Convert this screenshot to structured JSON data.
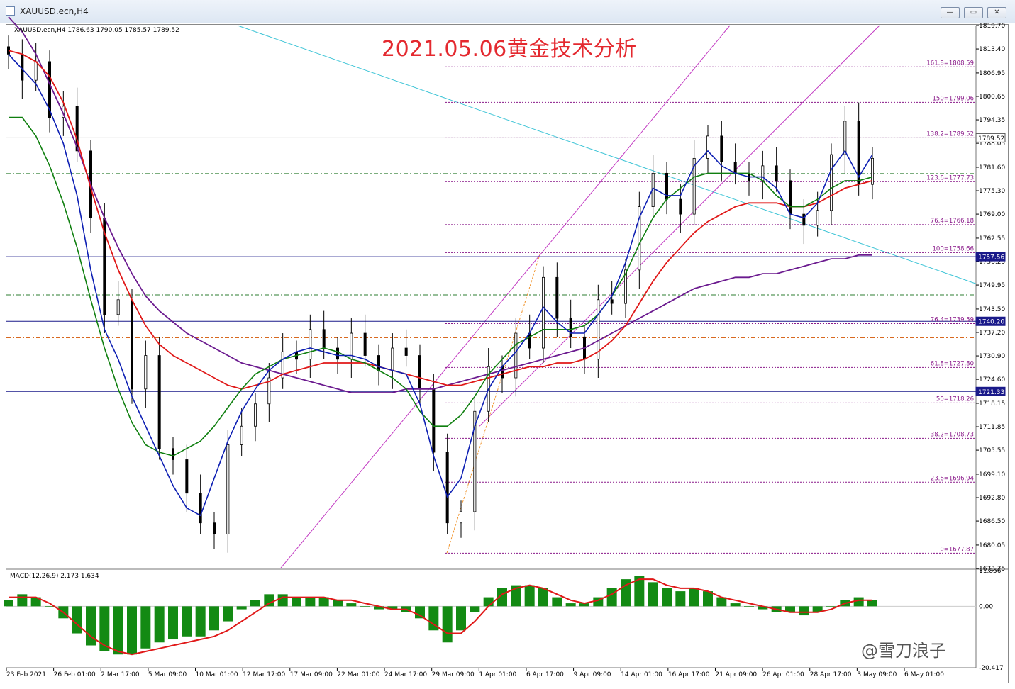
{
  "window": {
    "title": "XAUUSD.ecn,H4",
    "buttons": {
      "minimize": "—",
      "restore": "▭",
      "close": "✕"
    }
  },
  "chart_header": {
    "symbol_line": "XAUUSD.ecn,H4  1786.63 1790.05 1785.57 1789.52",
    "macd_line": "MACD(12,26,9) 2.173 1.634"
  },
  "headline": "2021.05.06黄金技术分析",
  "watermark": "@雪刀浪子",
  "colors": {
    "candle": "#000000",
    "ma_fast": "#0d1fb3",
    "ma_green": "#0f7f0f",
    "ma_red": "#e01818",
    "ma_purple": "#6b1a8f",
    "fib": "#8a1a8a",
    "trend_cyan": "#3cc4d6",
    "channel": "#c23ac2",
    "hline": "#1a1a8a",
    "macd_hist": "#138a13",
    "macd_signal": "#e01818",
    "headline": "#e4292f"
  },
  "chart_data": {
    "type": "candlestick",
    "symbol": "XAUUSD.ecn",
    "timeframe": "H4",
    "last": {
      "open": 1786.63,
      "high": 1790.05,
      "low": 1785.57,
      "close": 1789.52
    },
    "price_axis": [
      1819.7,
      1813.4,
      1806.95,
      1800.65,
      1794.35,
      1788.05,
      1781.6,
      1775.3,
      1769.0,
      1762.55,
      1756.25,
      1749.95,
      1743.5,
      1737.2,
      1730.9,
      1724.6,
      1718.15,
      1711.85,
      1705.55,
      1699.1,
      1692.8,
      1686.5,
      1680.05,
      1673.75
    ],
    "ylim": [
      1673.75,
      1819.7
    ],
    "time_axis": [
      "23 Feb 2021",
      "26 Feb 01:00",
      "2 Mar 17:00",
      "5 Mar 09:00",
      "10 Mar 01:00",
      "12 Mar 17:00",
      "17 Mar 09:00",
      "22 Mar 01:00",
      "24 Mar 17:00",
      "29 Mar 09:00",
      "1 Apr 01:00",
      "6 Apr 17:00",
      "9 Apr 09:00",
      "14 Apr 01:00",
      "16 Apr 17:00",
      "21 Apr 09:00",
      "26 Apr 01:00",
      "28 Apr 17:00",
      "3 May 09:00",
      "6 May 01:00"
    ],
    "fib_levels": [
      {
        "label": "161.8=1808.59",
        "value": 1808.59
      },
      {
        "label": "150=1799.06",
        "value": 1799.06
      },
      {
        "label": "138.2=1789.52",
        "value": 1789.52
      },
      {
        "label": "123.6=1777.73",
        "value": 1777.73
      },
      {
        "label": "76.4=1766.18",
        "value": 1766.18
      },
      {
        "label": "100=1758.66",
        "value": 1758.66
      },
      {
        "label": "76.4=1739.59",
        "value": 1739.59
      },
      {
        "label": "61.8=1727.80",
        "value": 1727.8
      },
      {
        "label": "50=1718.26",
        "value": 1718.26
      },
      {
        "label": "38.2=1708.73",
        "value": 1708.73
      },
      {
        "label": "23.6=1696.94",
        "value": 1696.94
      },
      {
        "label": "0=1677.87",
        "value": 1677.87
      }
    ],
    "price_tags": [
      {
        "label": "1789.52",
        "value": 1789.52,
        "style": "current"
      },
      {
        "label": "1757.56",
        "value": 1757.56,
        "style": "line"
      },
      {
        "label": "1740.20",
        "value": 1740.2,
        "style": "line"
      },
      {
        "label": "1721.33",
        "value": 1721.33,
        "style": "line"
      }
    ],
    "dash_levels": [
      1779.9,
      1747.3,
      1735.8
    ],
    "macd_axis": [
      "11.856",
      "0.00",
      "-20.417"
    ],
    "macd_range": [
      -20.417,
      11.856
    ],
    "path_points": [
      1812,
      1805,
      1810,
      1795,
      1798,
      1786,
      1768,
      1742,
      1746,
      1722,
      1731,
      1706,
      1703,
      1694,
      1686,
      1683,
      1707,
      1712,
      1718,
      1725,
      1732,
      1730,
      1738,
      1733,
      1730,
      1737,
      1731,
      1727,
      1733,
      1731,
      1722,
      1705,
      1686,
      1689,
      1716,
      1728,
      1725,
      1737,
      1733,
      1752,
      1741,
      1736,
      1730,
      1746,
      1745,
      1754,
      1771,
      1780,
      1773,
      1769,
      1784,
      1790,
      1783,
      1780,
      1778,
      1782,
      1778,
      1769,
      1766,
      1770,
      1785,
      1794,
      1777,
      1784
    ],
    "ma_fast": [
      1812,
      1808,
      1804,
      1797,
      1788,
      1774,
      1754,
      1738,
      1730,
      1720,
      1712,
      1704,
      1696,
      1690,
      1688,
      1698,
      1708,
      1716,
      1722,
      1727,
      1730,
      1732,
      1733,
      1732,
      1731,
      1731,
      1730,
      1728,
      1727,
      1726,
      1718,
      1704,
      1693,
      1698,
      1712,
      1722,
      1728,
      1732,
      1737,
      1744,
      1740,
      1737,
      1737,
      1742,
      1747,
      1756,
      1768,
      1776,
      1774,
      1774,
      1782,
      1786,
      1782,
      1780,
      1779,
      1779,
      1776,
      1769,
      1768,
      1772,
      1781,
      1786,
      1779,
      1785
    ],
    "ma_green": [
      1795,
      1795,
      1790,
      1782,
      1772,
      1760,
      1746,
      1733,
      1722,
      1713,
      1707,
      1705,
      1704,
      1706,
      1708,
      1712,
      1717,
      1722,
      1726,
      1728,
      1730,
      1731,
      1732,
      1733,
      1732,
      1730,
      1729,
      1727,
      1725,
      1722,
      1716,
      1712,
      1712,
      1715,
      1720,
      1726,
      1730,
      1734,
      1736,
      1738,
      1738,
      1738,
      1739,
      1742,
      1747,
      1753,
      1761,
      1768,
      1773,
      1776,
      1779,
      1780,
      1780,
      1780,
      1780,
      1778,
      1774,
      1771,
      1771,
      1773,
      1776,
      1778,
      1778,
      1779
    ],
    "ma_red": [
      1813,
      1812,
      1810,
      1806,
      1799,
      1789,
      1776,
      1764,
      1754,
      1746,
      1739,
      1734,
      1731,
      1729,
      1727,
      1725,
      1723,
      1722,
      1723,
      1724,
      1726,
      1727,
      1728,
      1729,
      1729,
      1729,
      1729,
      1728,
      1727,
      1726,
      1725,
      1724,
      1723,
      1723,
      1724,
      1725,
      1726,
      1727,
      1728,
      1728,
      1729,
      1729,
      1730,
      1732,
      1735,
      1739,
      1745,
      1751,
      1756,
      1760,
      1764,
      1767,
      1769,
      1771,
      1772,
      1772,
      1772,
      1771,
      1771,
      1772,
      1774,
      1776,
      1777,
      1778
    ],
    "ma_purple": [
      1822,
      1818,
      1812,
      1804,
      1796,
      1787,
      1777,
      1768,
      1760,
      1753,
      1747,
      1743,
      1740,
      1737,
      1735,
      1733,
      1731,
      1729,
      1728,
      1727,
      1726,
      1725,
      1724,
      1723,
      1722,
      1721,
      1721,
      1721,
      1721,
      1722,
      1722,
      1722,
      1723,
      1724,
      1725,
      1726,
      1727,
      1728,
      1729,
      1730,
      1731,
      1732,
      1733,
      1735,
      1737,
      1739,
      1741,
      1743,
      1745,
      1747,
      1749,
      1750,
      1751,
      1752,
      1752,
      1753,
      1753,
      1754,
      1755,
      1756,
      1757,
      1757,
      1758,
      1758
    ],
    "macd_hist": [
      2,
      4,
      3,
      0,
      -4,
      -9,
      -13,
      -15,
      -16,
      -16,
      -14,
      -12,
      -11,
      -10,
      -10,
      -8,
      -5,
      -1,
      2,
      4,
      4,
      3,
      3,
      3,
      2,
      1,
      0,
      -1,
      -1,
      -2,
      -4,
      -8,
      -12,
      -8,
      -2,
      3,
      6,
      7,
      7,
      6,
      3,
      1,
      1,
      3,
      6,
      9,
      10,
      8,
      6,
      5,
      6,
      5,
      3,
      1,
      0,
      -1,
      -2,
      -2,
      -3,
      -2,
      0,
      2,
      3,
      2
    ],
    "macd_signal": [
      3,
      3,
      3,
      1,
      -2,
      -6,
      -10,
      -13,
      -15,
      -16,
      -15,
      -14,
      -13,
      -12,
      -11,
      -10,
      -8,
      -5,
      -2,
      1,
      3,
      3,
      3,
      3,
      2,
      2,
      1,
      0,
      -1,
      -1,
      -3,
      -6,
      -9,
      -9,
      -5,
      0,
      4,
      6,
      7,
      6,
      4,
      2,
      1,
      2,
      4,
      7,
      9,
      9,
      7,
      6,
      6,
      5,
      3,
      2,
      1,
      0,
      -1,
      -2,
      -2,
      -2,
      -1,
      1,
      2,
      2
    ]
  }
}
